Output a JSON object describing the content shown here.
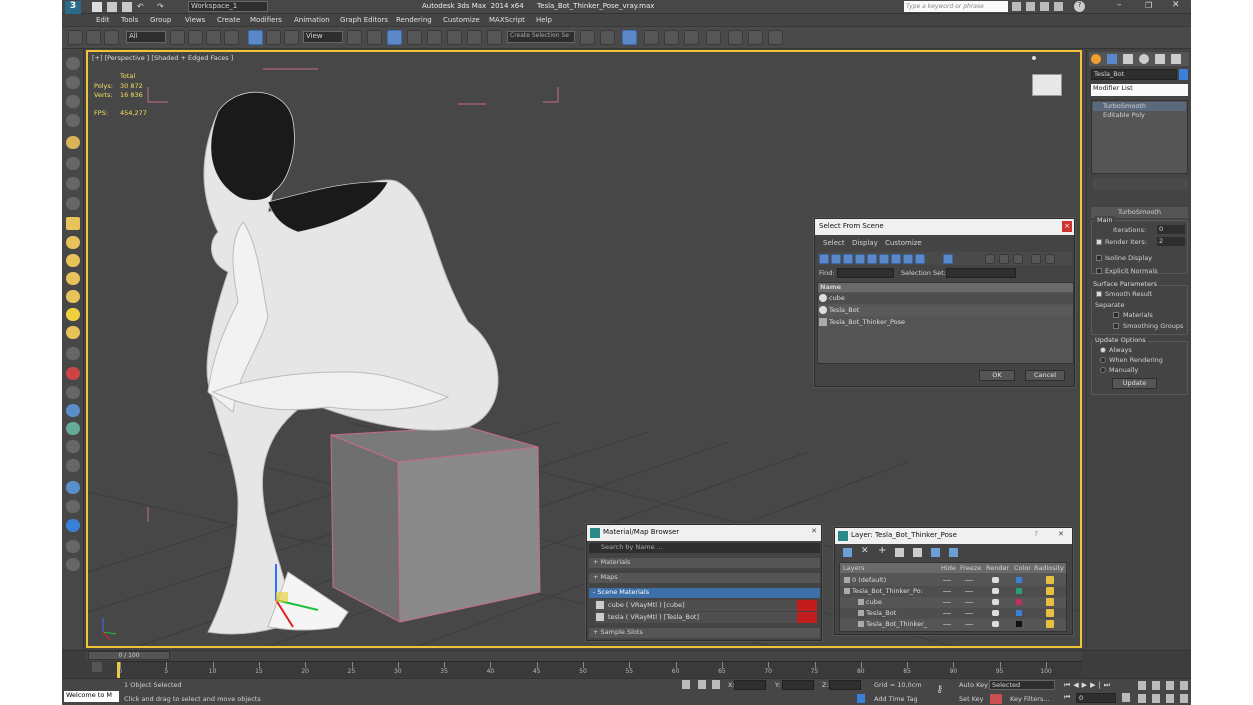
{
  "titlebar": {
    "workspace": "Workspace_1",
    "title": "Autodesk 3ds Max  2014 x64      Tesla_Bot_Thinker_Pose_vray.max",
    "search_placeholder": "Type a keyword or phrase"
  },
  "menu": [
    "Edit",
    "Tools",
    "Group",
    "Views",
    "Create",
    "Modifiers",
    "Animation",
    "Graph Editors",
    "Rendering",
    "Customize",
    "MAXScript",
    "Help"
  ],
  "toolbar": {
    "filter": "All",
    "ref_coord": "View",
    "selection_set": "Create Selection Se"
  },
  "viewport": {
    "label": "[+] [Perspective ] [Shaded + Edged Faces ]",
    "stats_header": "Total",
    "polys_label": "Polys:",
    "polys_value": "30 872",
    "verts_label": "Verts:",
    "verts_value": "16 836",
    "fps_label": "FPS:",
    "fps_value": "454,277"
  },
  "command_panel": {
    "object_name": "Tesla_Bot",
    "modifier_list": "Modifier List",
    "stack": [
      "TurboSmooth",
      "Editable Poly"
    ],
    "rollout_title": "TurboSmooth",
    "main_label": "Main",
    "iterations_label": "Iterations:",
    "iterations_value": "0",
    "render_iters_label": "Render Iters:",
    "render_iters_value": "2",
    "isoline": "Isoline Display",
    "explicit_normals": "Explicit Normals",
    "surface_params": "Surface Parameters",
    "smooth_result": "Smooth Result",
    "separate": "Separate",
    "materials": "Materials",
    "smoothing_groups": "Smoothing Groups",
    "update_options": "Update Options",
    "always": "Always",
    "when_rendering": "When Rendering",
    "manually": "Manually",
    "update_btn": "Update"
  },
  "select_dialog": {
    "title": "Select From Scene",
    "menus": [
      "Select",
      "Display",
      "Customize"
    ],
    "find_label": "Find:",
    "selset_label": "Selection Set:",
    "col_name": "Name",
    "items": [
      "cube",
      "Tesla_Bot",
      "Tesla_Bot_Thinker_Pose"
    ],
    "ok": "OK",
    "cancel": "Cancel"
  },
  "material_browser": {
    "title": "Material/Map Browser",
    "search": "Search by Name ...",
    "sections": [
      "+ Materials",
      "+ Maps",
      "- Scene Materials"
    ],
    "materials": [
      "cube  ( VRayMtl ) [cube]",
      "tesla  ( VRayMtl ) [Tesla_Bot]"
    ],
    "sample_slots": "+ Sample Slots"
  },
  "layer_dialog": {
    "title": "Layer: Tesla_Bot_Thinker_Pose",
    "headers": [
      "Layers",
      "Hide",
      "Freeze",
      "Render",
      "Color",
      "Radiosity"
    ],
    "rows": [
      {
        "name": "0 (default)",
        "color": "#3a7fd8"
      },
      {
        "name": "Tesla_Bot_Thinker_Po:",
        "color": "#2aa070"
      },
      {
        "name": "cube",
        "color": "#c0305a"
      },
      {
        "name": "Tesla_Bot",
        "color": "#3a7fd8"
      },
      {
        "name": "Tesla_Bot_Thinker_",
        "color": "#111111"
      }
    ]
  },
  "timeline": {
    "frame": "0 / 100",
    "ticks": [
      "0",
      "5",
      "10",
      "15",
      "20",
      "25",
      "30",
      "35",
      "40",
      "45",
      "50",
      "55",
      "60",
      "65",
      "70",
      "75",
      "80",
      "85",
      "90",
      "95",
      "100"
    ]
  },
  "status": {
    "welcome": "Welcome to M",
    "selected": "1 Object Selected",
    "prompt": "Click and drag to select and move objects",
    "x_label": "X:",
    "y_label": "Y:",
    "z_label": "Z:",
    "grid": "Grid = 10,0cm",
    "auto_key": "Auto Key",
    "set_key": "Set Key",
    "selected_dd": "Selected",
    "key_filters": "Key Filters...",
    "add_time_tag": "Add Time Tag",
    "frame_field": "0"
  }
}
